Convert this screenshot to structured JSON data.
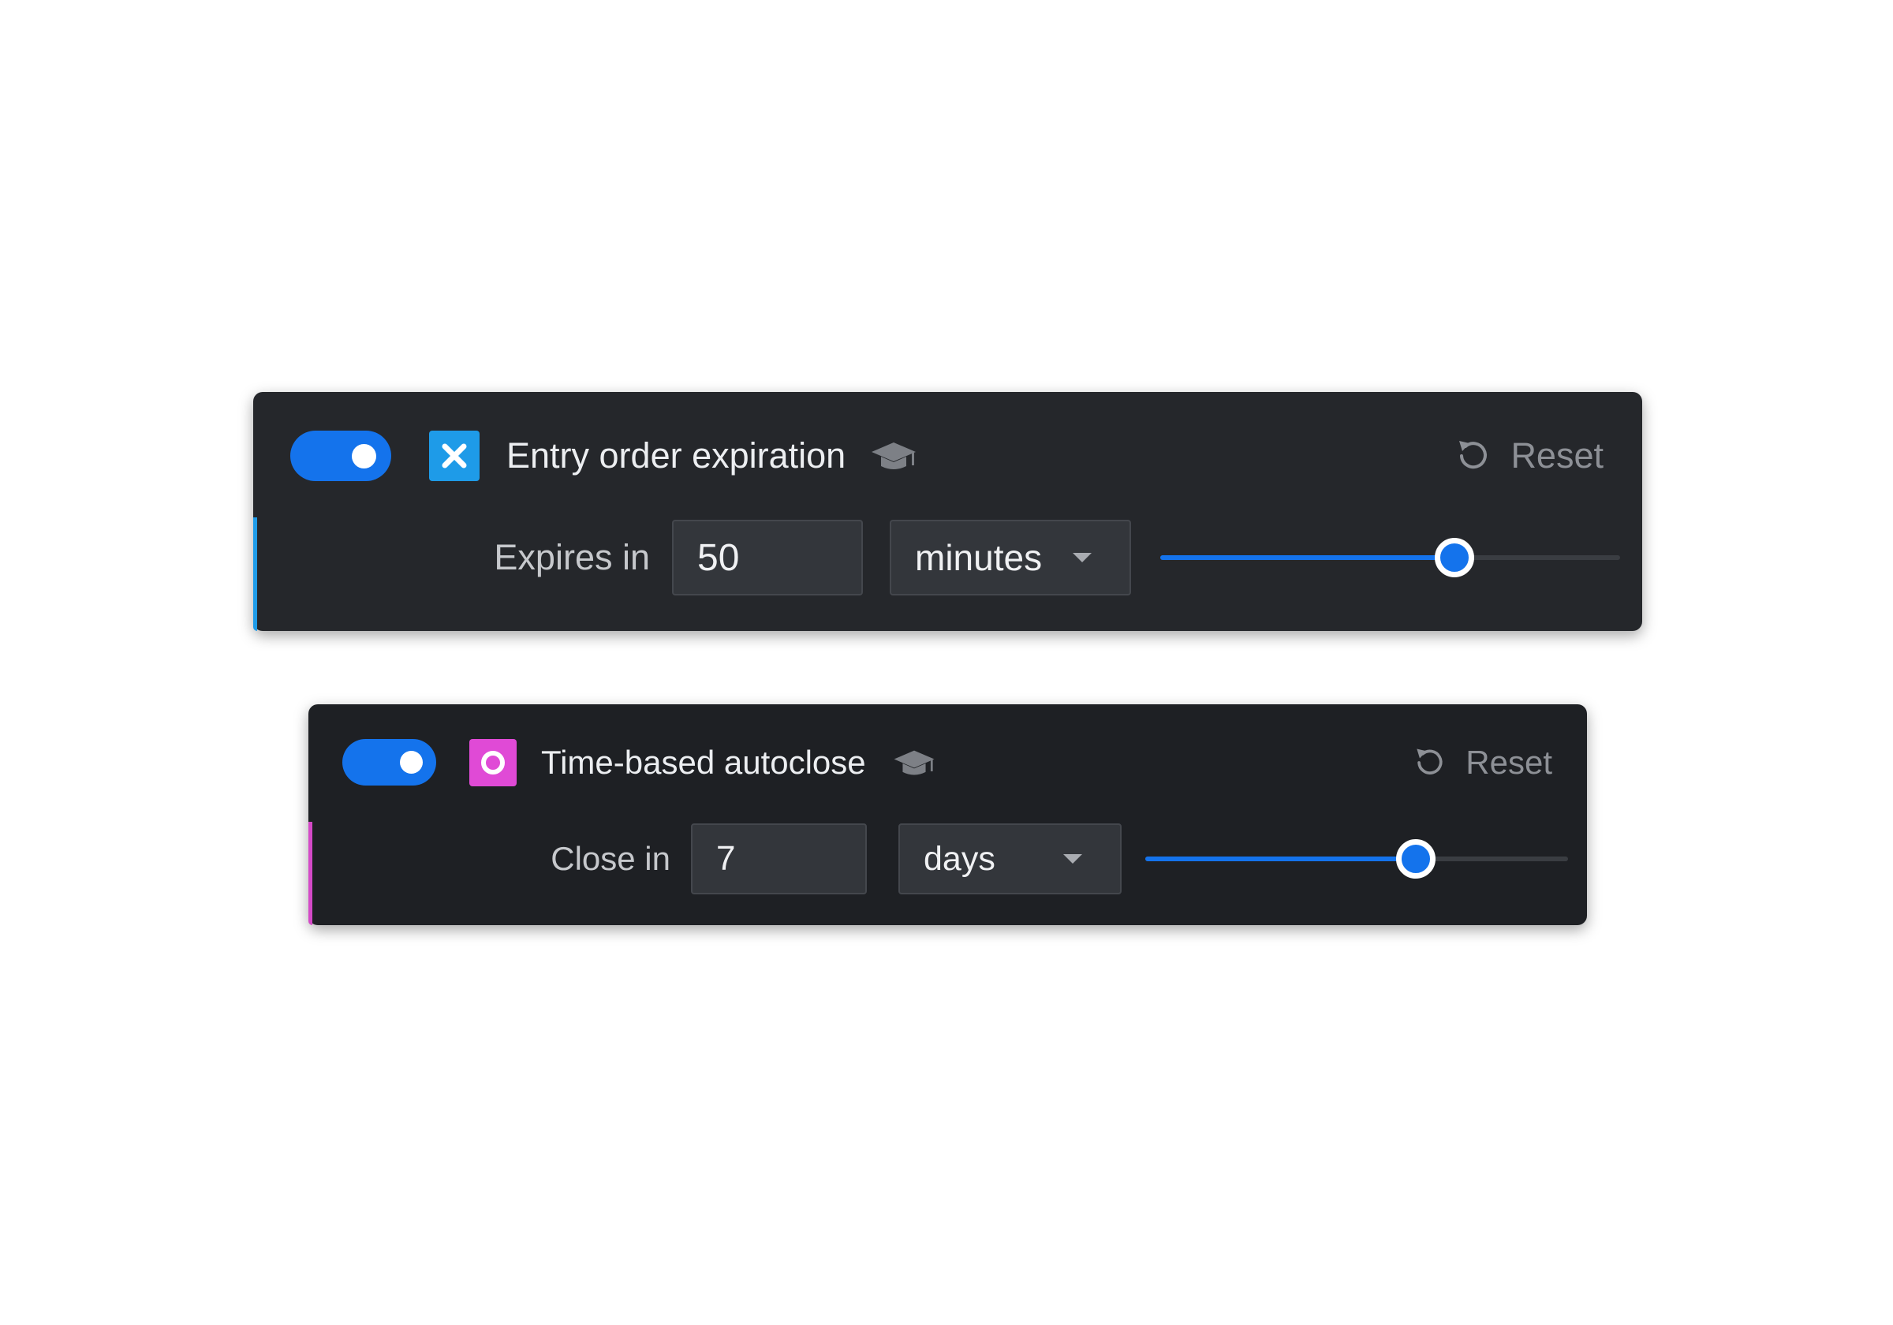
{
  "colors": {
    "toggle_on": "#1473ec",
    "entry_accent": "#1e9be8",
    "autoclose_accent": "#e04ad6",
    "panel_bg": "#25272b",
    "muted_text": "#8d9096"
  },
  "panels": [
    {
      "enabled": true,
      "type_icon": "x-close-icon",
      "title": "Entry order expiration",
      "info_icon": "graduation-cap-icon",
      "reset_icon": "reset-icon",
      "reset_label": "Reset",
      "field_label": "Expires in",
      "value": "50",
      "unit": "minutes",
      "slider_level": 0.64
    },
    {
      "enabled": true,
      "type_icon": "ring-icon",
      "title": "Time-based autoclose",
      "info_icon": "graduation-cap-icon",
      "reset_icon": "reset-icon",
      "reset_label": "Reset",
      "field_label": "Close in",
      "value": "7",
      "unit": "days",
      "slider_level": 0.64
    }
  ]
}
